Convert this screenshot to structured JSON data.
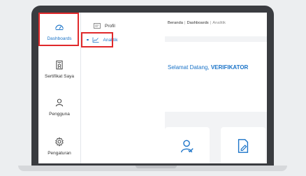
{
  "sidebar": {
    "items": [
      {
        "label": "Dashboards",
        "icon": "dashboard-gauge-icon"
      },
      {
        "label": "Sertifikat Saya",
        "icon": "certificate-icon"
      },
      {
        "label": "Pengguna",
        "icon": "user-icon"
      },
      {
        "label": "Pengaturan",
        "icon": "gear-icon"
      }
    ]
  },
  "submenu": {
    "items": [
      {
        "label": "Profil",
        "icon": "id-card-icon"
      },
      {
        "label": "Analitik",
        "icon": "chart-icon"
      }
    ]
  },
  "header": {
    "breadcrumb": [
      "Beranda",
      "Dashboards",
      "Analitik"
    ]
  },
  "main": {
    "welcome_prefix": "Selamat Datang,",
    "welcome_name": "VERIFIKATOR"
  },
  "colors": {
    "accent": "#1a73c8",
    "highlight": "#e0292b"
  }
}
